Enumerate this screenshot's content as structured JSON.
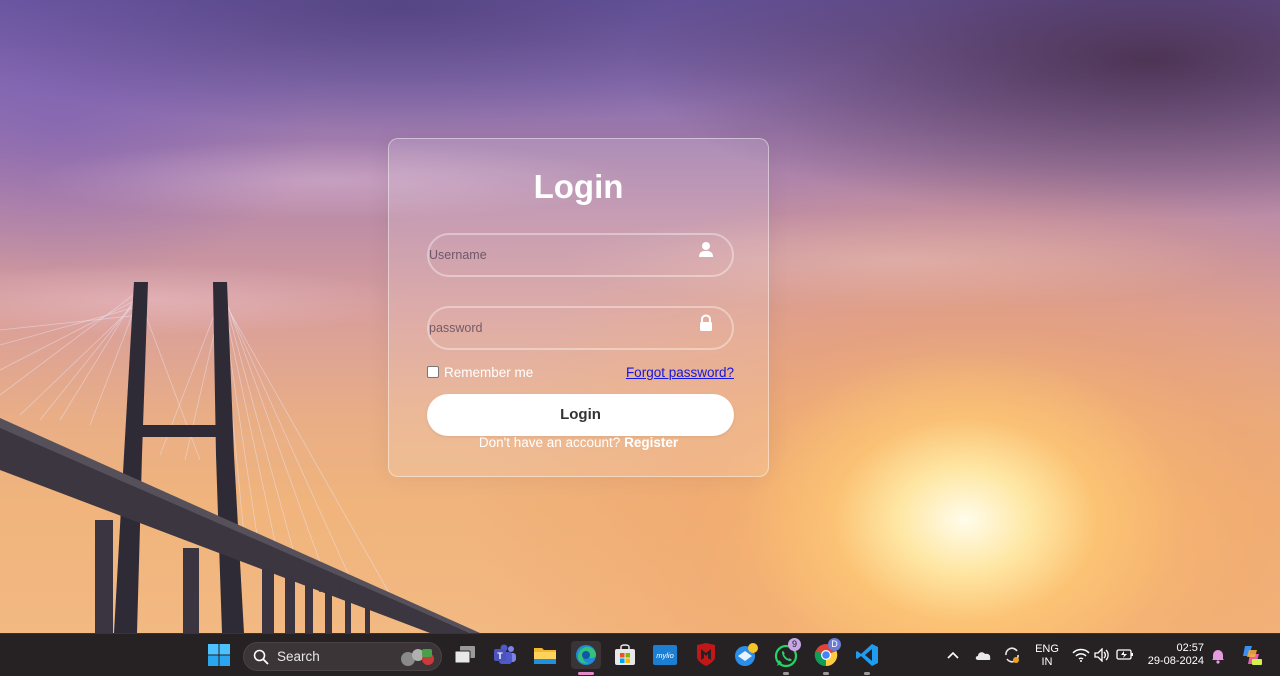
{
  "login": {
    "title": "Login",
    "username_placeholder": "Username",
    "password_placeholder": "password",
    "remember_label": "Remember me",
    "forgot_label": "Forgot password?",
    "submit_label": "Login",
    "no_account_text": "Don't have an account?",
    "register_label": "Register"
  },
  "taskbar": {
    "search_label": "Search",
    "apps": [
      "windows-start",
      "task-view",
      "teams",
      "file-explorer",
      "edge",
      "microsoft-store",
      "mylio",
      "mcafee",
      "thunderbird",
      "whatsapp",
      "chrome",
      "vscode"
    ],
    "whatsapp_badge": "9",
    "chrome_badge": "D"
  },
  "tray": {
    "lang_top": "ENG",
    "lang_bottom": "IN",
    "time": "02:57",
    "date": "29-08-2024"
  },
  "colors": {
    "link": "#1515e0",
    "taskbar": "#262223",
    "edge_active": "#e58ac9"
  }
}
